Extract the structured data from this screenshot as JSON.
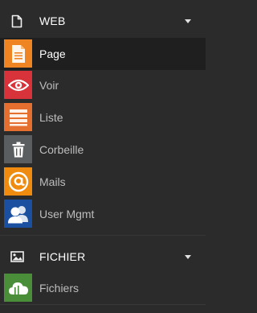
{
  "sections": {
    "web": {
      "title": "WEB",
      "icon": "file-outline-icon",
      "items": [
        {
          "label": "Page",
          "icon": "document-icon",
          "color": "#ef8522",
          "active": true
        },
        {
          "label": "Voir",
          "icon": "eye-icon",
          "color": "#d8323a",
          "active": false
        },
        {
          "label": "Liste",
          "icon": "list-icon",
          "color": "#e46f2e",
          "active": false
        },
        {
          "label": "Corbeille",
          "icon": "trash-icon",
          "color": "#5a5e60",
          "active": false
        },
        {
          "label": "Mails",
          "icon": "at-sign-icon",
          "color": "#ef8c0f",
          "active": false
        },
        {
          "label": "User Mgmt",
          "icon": "users-icon",
          "color": "#1b4fa0",
          "active": false
        }
      ]
    },
    "fichier": {
      "title": "FICHIER",
      "icon": "image-icon",
      "items": [
        {
          "label": "Fichiers",
          "icon": "cloud-icon",
          "color": "#4a8e3a",
          "active": false
        }
      ]
    }
  }
}
